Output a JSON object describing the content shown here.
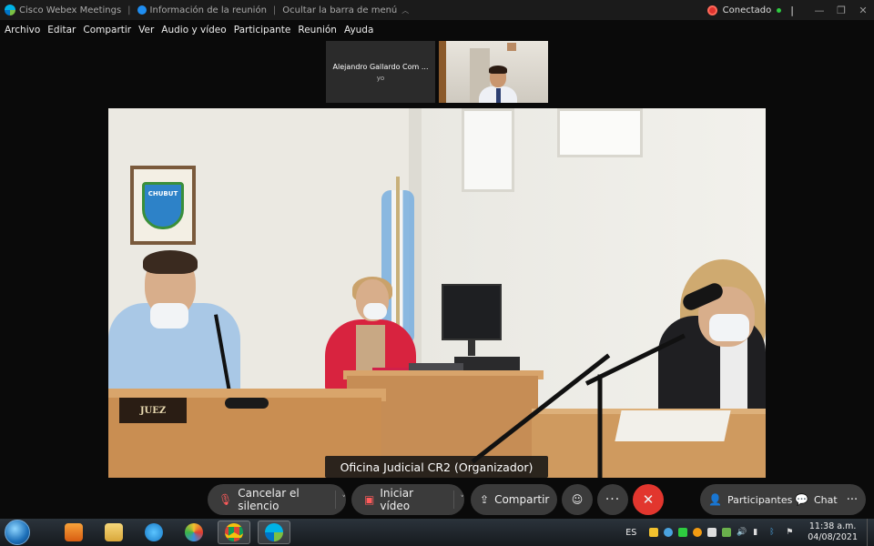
{
  "titlebar": {
    "app_name": "Cisco Webex Meetings",
    "meeting_info": "Información de la reunión",
    "hide_menu": "Ocultar la barra de menú",
    "status": "Conectado",
    "window_controls": {
      "minimize": "—",
      "maximize": "❐",
      "close": "✕"
    }
  },
  "menu": [
    "Archivo",
    "Editar",
    "Compartir",
    "Ver",
    "Audio y vídeo",
    "Participante",
    "Reunión",
    "Ayuda"
  ],
  "thumbnails": [
    {
      "name": "Alejandro Gallardo Com ...",
      "sub": "yo"
    }
  ],
  "main_video": {
    "sign_text": "JUEZ",
    "shield_text": "CHUBUT",
    "speaker_label": "Oficina Judicial CR2 (Organizador)"
  },
  "controls": {
    "mute_label": "Cancelar el silencio",
    "video_label": "Iniciar vídeo",
    "share_label": "Compartir",
    "participants_label": "Participantes",
    "chat_label": "Chat"
  },
  "taskbar": {
    "language": "ES",
    "time": "11:38 a.m.",
    "date": "04/08/2021"
  }
}
